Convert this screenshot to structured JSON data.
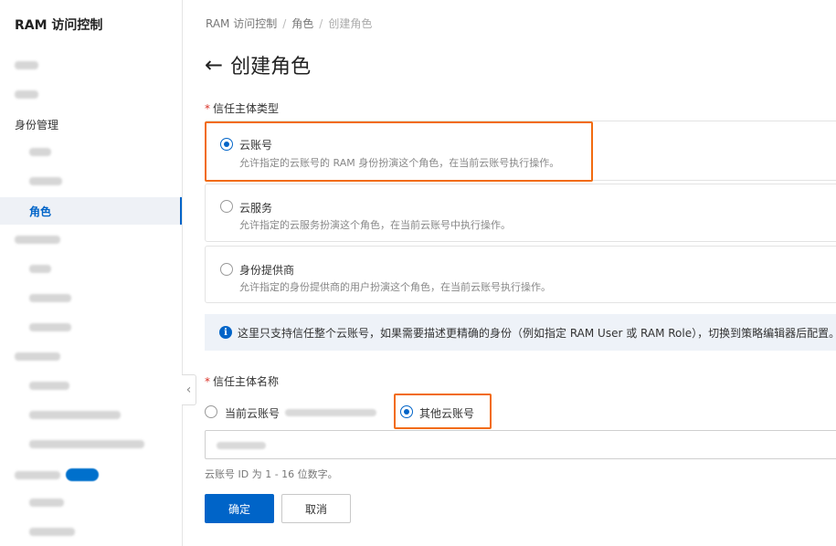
{
  "sidebar": {
    "app_title": "RAM 访问控制",
    "items": [
      {
        "label": "身份管理"
      },
      {
        "label": "角色"
      }
    ]
  },
  "breadcrumb": [
    "RAM 访问控制",
    "角色",
    "创建角色"
  ],
  "page": {
    "back_icon": "arrow-left-icon",
    "title": "创建角色"
  },
  "trust_type": {
    "label": "信任主体类型",
    "required_mark": "*",
    "options": [
      {
        "title": "云账号",
        "desc": "允许指定的云账号的 RAM 身份扮演这个角色，在当前云账号执行操作。",
        "checked": true
      },
      {
        "title": "云服务",
        "desc": "允许指定的云服务扮演这个角色，在当前云账号中执行操作。",
        "checked": false
      },
      {
        "title": "身份提供商",
        "desc": "允许指定的身份提供商的用户扮演这个角色，在当前云账号执行操作。",
        "checked": false
      }
    ]
  },
  "info": {
    "icon": "info-circle-icon",
    "text": "这里只支持信任整个云账号，如果需要描述更精确的身份（例如指定 RAM User 或 RAM Role），切换到策略编辑器后配置。"
  },
  "trust_name": {
    "label": "信任主体名称",
    "required_mark": "*",
    "options": [
      {
        "label": "当前云账号",
        "checked": false
      },
      {
        "label": "其他云账号",
        "checked": true
      }
    ],
    "hint": "云账号 ID 为 1 - 16 位数字。"
  },
  "buttons": {
    "confirm": "确定",
    "cancel": "取消"
  },
  "colors": {
    "primary": "#0064c8",
    "highlight": "#f26b10",
    "required": "#d93026"
  }
}
